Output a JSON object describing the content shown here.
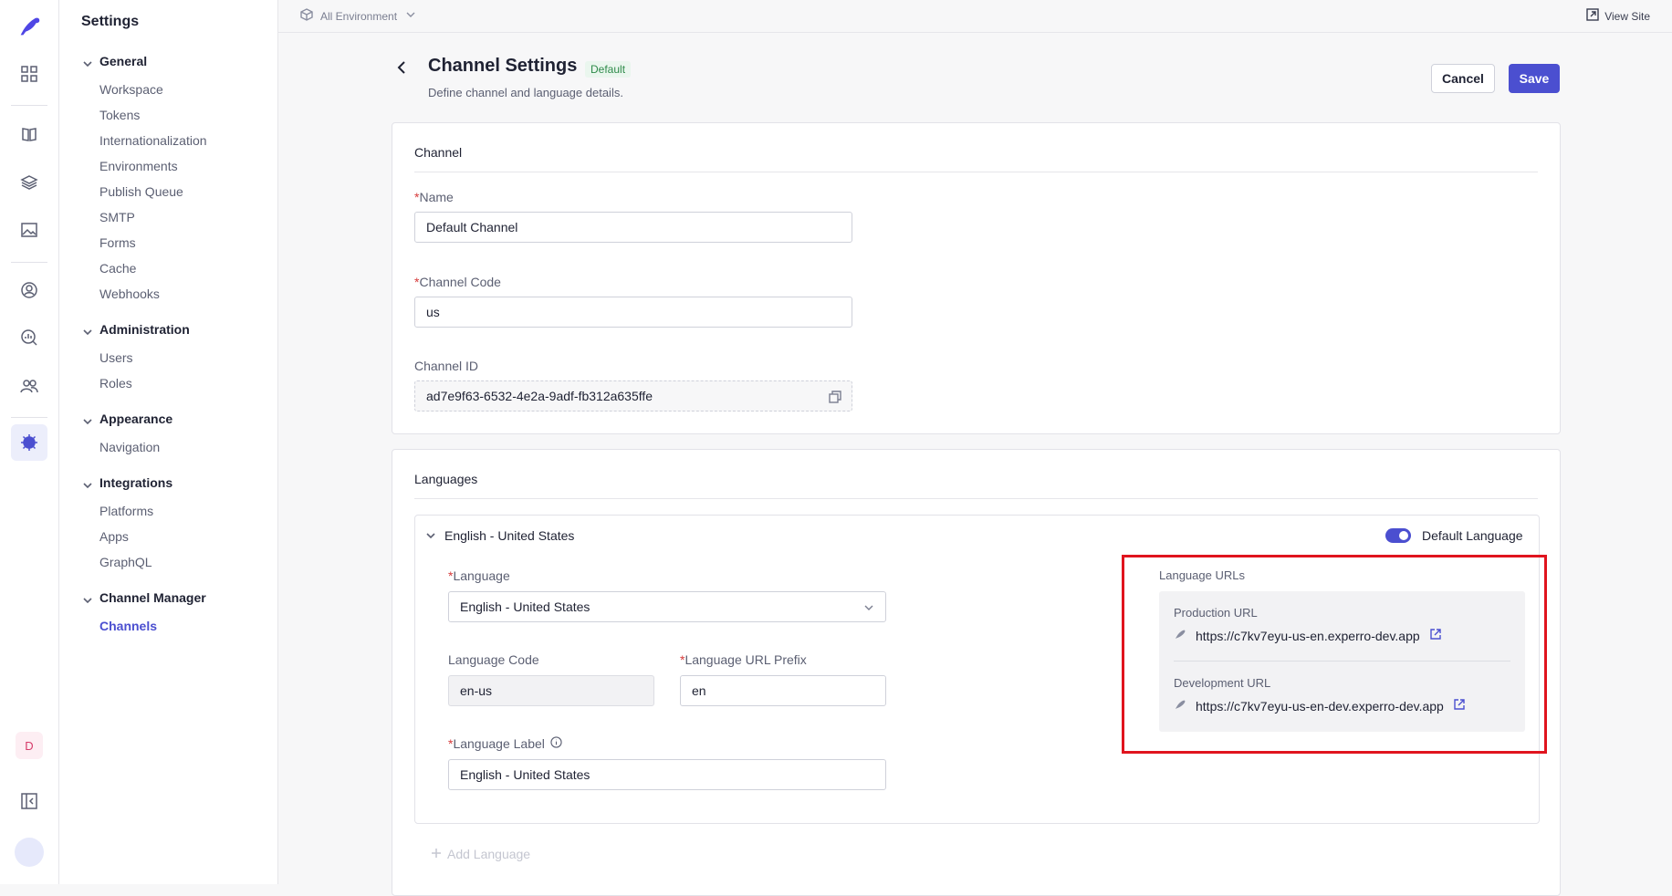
{
  "topbar": {
    "environment": "All Environment",
    "view_site": "View Site"
  },
  "sidebar": {
    "title": "Settings",
    "groups": [
      {
        "label": "General",
        "items": [
          "Workspace",
          "Tokens",
          "Internationalization",
          "Environments",
          "Publish Queue",
          "SMTP",
          "Forms",
          "Cache",
          "Webhooks"
        ]
      },
      {
        "label": "Administration",
        "items": [
          "Users",
          "Roles"
        ]
      },
      {
        "label": "Appearance",
        "items": [
          "Navigation"
        ]
      },
      {
        "label": "Integrations",
        "items": [
          "Platforms",
          "Apps",
          "GraphQL"
        ]
      },
      {
        "label": "Channel Manager",
        "items": [
          "Channels"
        ]
      }
    ],
    "active_item": "Channels"
  },
  "rail": {
    "workspace_initial": "D"
  },
  "header": {
    "title": "Channel Settings",
    "badge": "Default",
    "subtitle": "Define channel and language details.",
    "cancel_label": "Cancel",
    "save_label": "Save"
  },
  "channel": {
    "section_title": "Channel",
    "required_mark": "*",
    "name_label": "Name",
    "name_value": "Default Channel",
    "code_label": "Channel Code",
    "code_value": "us",
    "id_label": "Channel ID",
    "id_value": "ad7e9f63-6532-4e2a-9adf-fb312a635ffe"
  },
  "languages": {
    "section_title": "Languages",
    "entry_title": "English - United States",
    "default_toggle_label": "Default Language",
    "default_toggle_on": true,
    "language_label": "Language",
    "language_value": "English - United States",
    "code_label": "Language Code",
    "code_value": "en-us",
    "prefix_label": "Language URL Prefix",
    "prefix_value": "en",
    "label_label": "Language Label",
    "label_value": "English - United States",
    "add_language": "Add Language",
    "urls": {
      "title": "Language URLs",
      "production_label": "Production URL",
      "production_url": "https://c7kv7eyu-us-en.experro-dev.app",
      "development_label": "Development URL",
      "development_url": "https://c7kv7eyu-us-en-dev.experro-dev.app"
    }
  },
  "colors": {
    "accent": "#4b4fd0",
    "highlight_box": "#e0141e",
    "badge_text": "#2e8b4a"
  }
}
